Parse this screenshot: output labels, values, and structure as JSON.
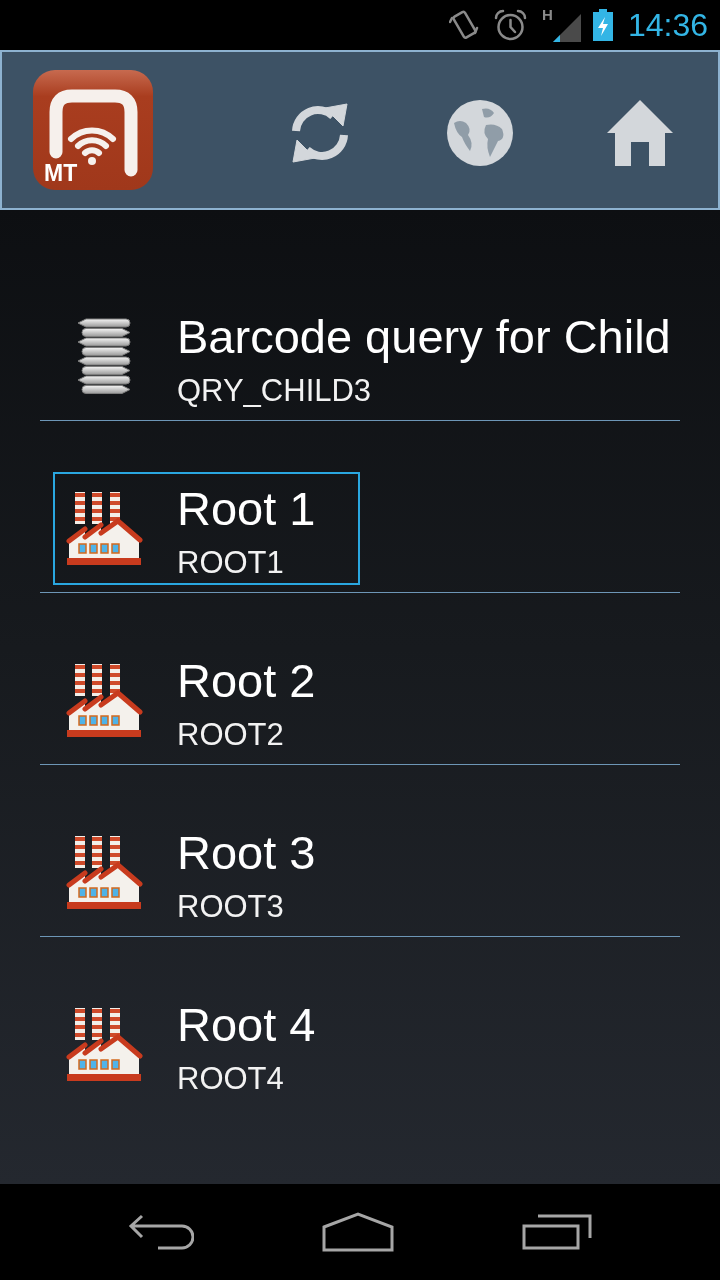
{
  "status_bar": {
    "network_type": "H",
    "time": "14:36"
  },
  "app_bar": {
    "logo_text": "MT"
  },
  "items": [
    {
      "kind": "query",
      "title": "Barcode query for Child",
      "code": "QRY_CHILD3",
      "selected": false
    },
    {
      "kind": "root",
      "title": "Root 1",
      "code": "ROOT1",
      "selected": true
    },
    {
      "kind": "root",
      "title": "Root 2",
      "code": "ROOT2",
      "selected": false
    },
    {
      "kind": "root",
      "title": "Root 3",
      "code": "ROOT3",
      "selected": false
    },
    {
      "kind": "root",
      "title": "Root 4",
      "code": "ROOT4",
      "selected": false
    }
  ]
}
